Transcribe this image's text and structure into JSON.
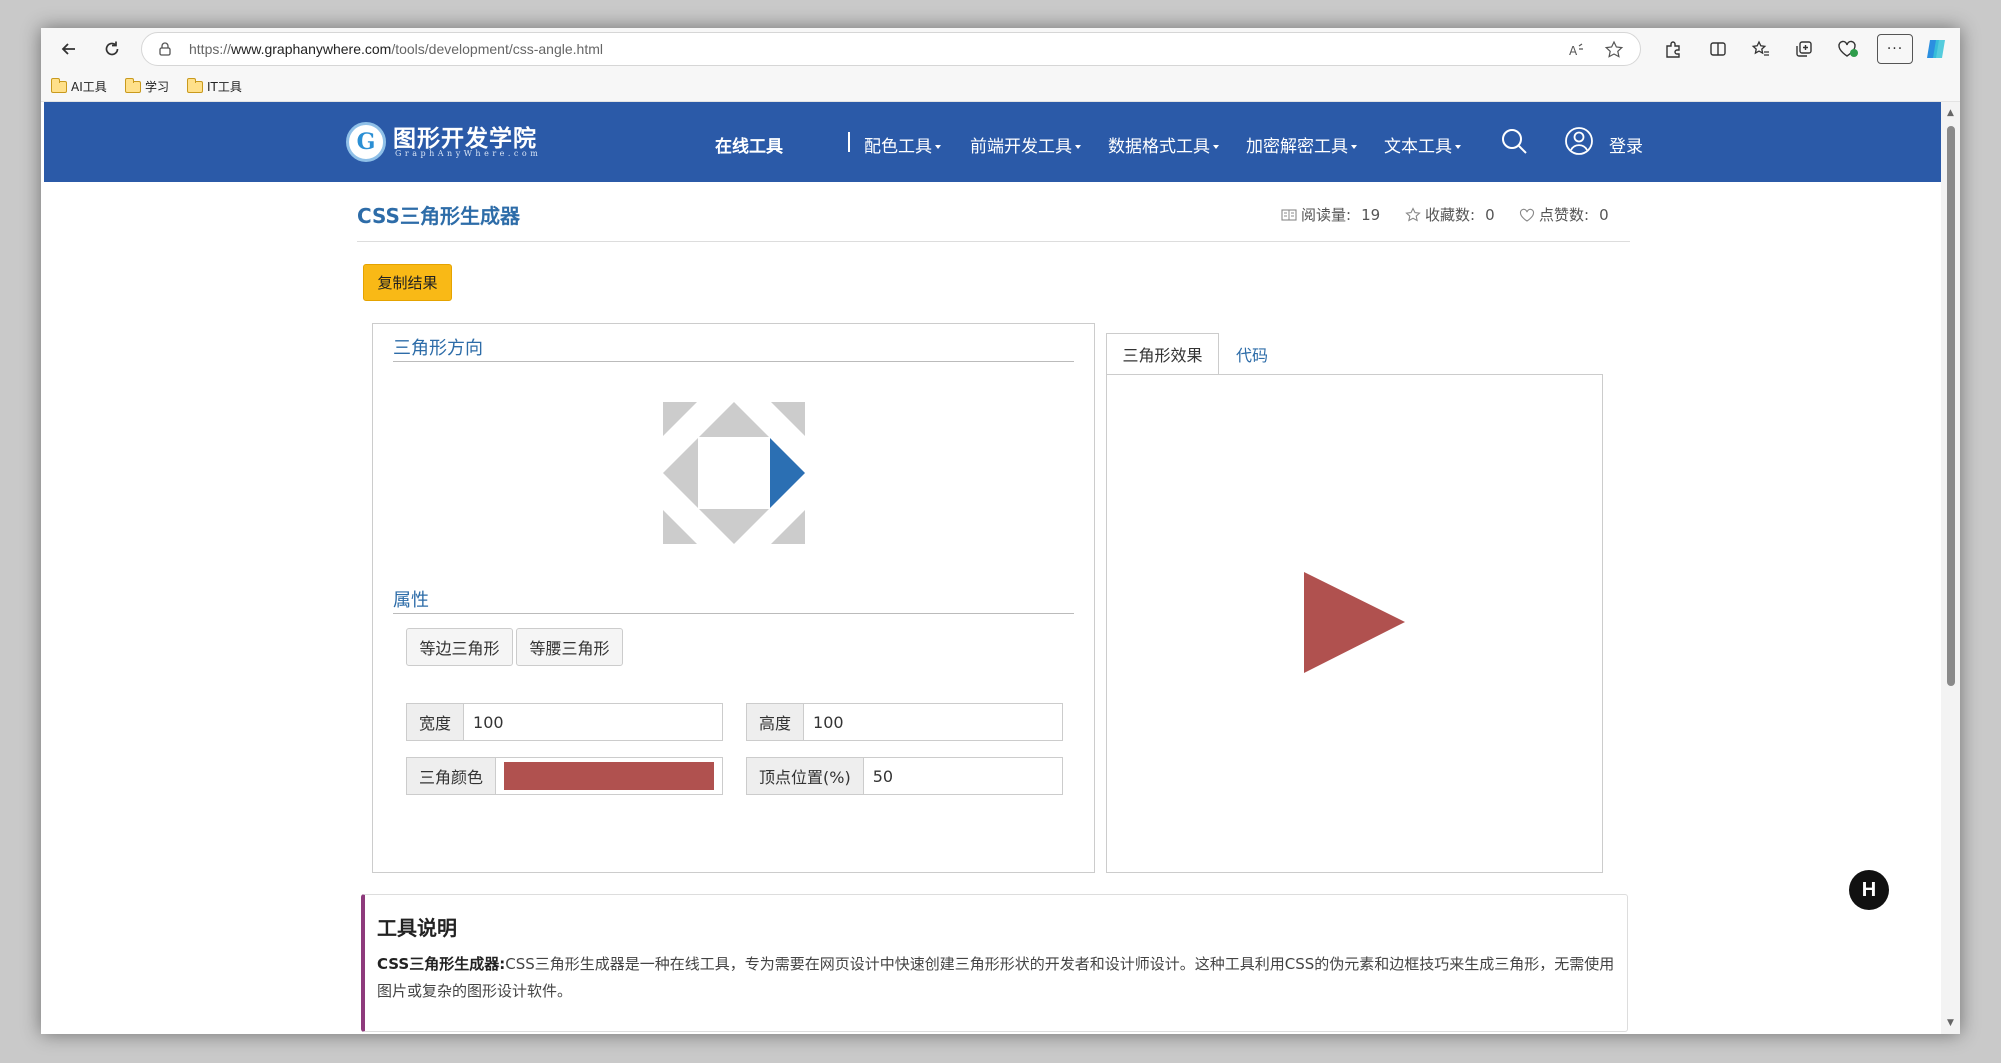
{
  "browser": {
    "url_prefix": "https://",
    "url_domain": "www.graphanywhere.com",
    "url_path": "/tools/development/css-angle.html",
    "bookmarks": [
      "AI工具",
      "学习",
      "IT工具"
    ]
  },
  "site": {
    "logo_title": "图形开发学院",
    "logo_sub": "GraphAnyWhere.com",
    "nav": {
      "online_tools": "在线工具",
      "color_tools": "配色工具",
      "frontend_tools": "前端开发工具",
      "data_format_tools": "数据格式工具",
      "crypto_tools": "加密解密工具",
      "text_tools": "文本工具",
      "login": "登录"
    }
  },
  "page": {
    "title": "CSS三角形生成器",
    "reads_label": "阅读量:",
    "reads_value": "19",
    "favorites_label": "收藏数:",
    "favorites_value": "0",
    "likes_label": "点赞数:",
    "likes_value": "0",
    "copy_button": "复制结果"
  },
  "direction": {
    "title": "三角形方向",
    "selected": "right",
    "selected_color": "#2b6fb3",
    "unselected_color": "#cccccc"
  },
  "props": {
    "title": "属性",
    "equilateral_btn": "等边三角形",
    "isosceles_btn": "等腰三角形",
    "width_label": "宽度",
    "width_value": "100",
    "height_label": "高度",
    "height_value": "100",
    "color_label": "三角颜色",
    "color_value": "#b0514f",
    "apex_label": "顶点位置(%)",
    "apex_value": "50"
  },
  "preview": {
    "tab_effect": "三角形效果",
    "tab_code": "代码",
    "triangle_color": "#b0514f"
  },
  "note": {
    "title": "工具说明",
    "lead": "CSS三角形生成器:",
    "text": "CSS三角形生成器是一种在线工具，专为需要在网页设计中快速创建三角形形状的开发者和设计师设计。这种工具利用CSS的伪元素和边框技巧来生成三角形，无需使用图片或复杂的图形设计软件。"
  }
}
